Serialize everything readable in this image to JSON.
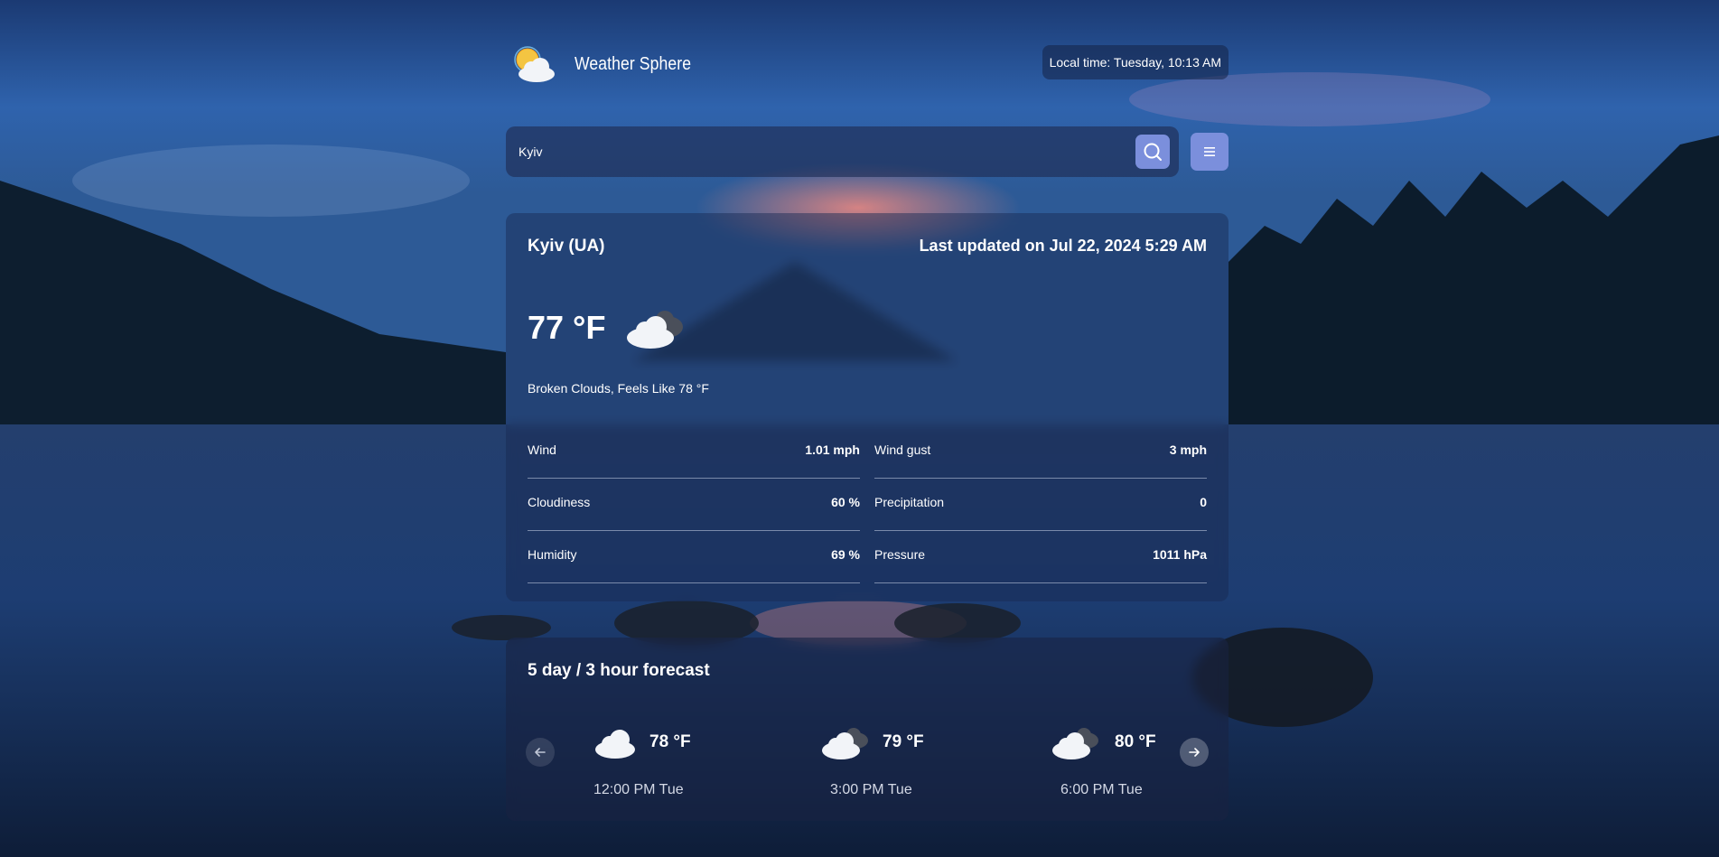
{
  "app": {
    "name": "Weather Sphere",
    "local_time": "Local time: Tuesday, 10:13 AM"
  },
  "search": {
    "value": "Kyiv",
    "placeholder": "Kyiv"
  },
  "current": {
    "city": "Kyiv (UA)",
    "updated": "Last updated on Jul 22, 2024 5:29 AM",
    "temperature": "77 °F",
    "icon": "broken-clouds-icon",
    "description": "Broken Clouds, Feels Like 78 °F",
    "details": [
      {
        "left_label": "Wind",
        "left_value": "1.01 mph",
        "right_label": "Wind gust",
        "right_value": "3 mph"
      },
      {
        "left_label": "Cloudiness",
        "left_value": "60 %",
        "right_label": "Precipitation",
        "right_value": "0"
      },
      {
        "left_label": "Humidity",
        "left_value": "69 %",
        "right_label": "Pressure",
        "right_value": "1011 hPa"
      }
    ]
  },
  "forecast": {
    "title": "5 day / 3 hour forecast",
    "items": [
      {
        "temp": "78 °F",
        "time": "12:00 PM Tue",
        "icon": "cloud-icon"
      },
      {
        "temp": "79 °F",
        "time": "3:00 PM Tue",
        "icon": "broken-clouds-icon"
      },
      {
        "temp": "80 °F",
        "time": "6:00 PM Tue",
        "icon": "broken-clouds-icon"
      }
    ]
  },
  "colors": {
    "accent_button": "#7b8fdc",
    "card_bg": "rgba(25, 40, 80, 0.45)"
  }
}
